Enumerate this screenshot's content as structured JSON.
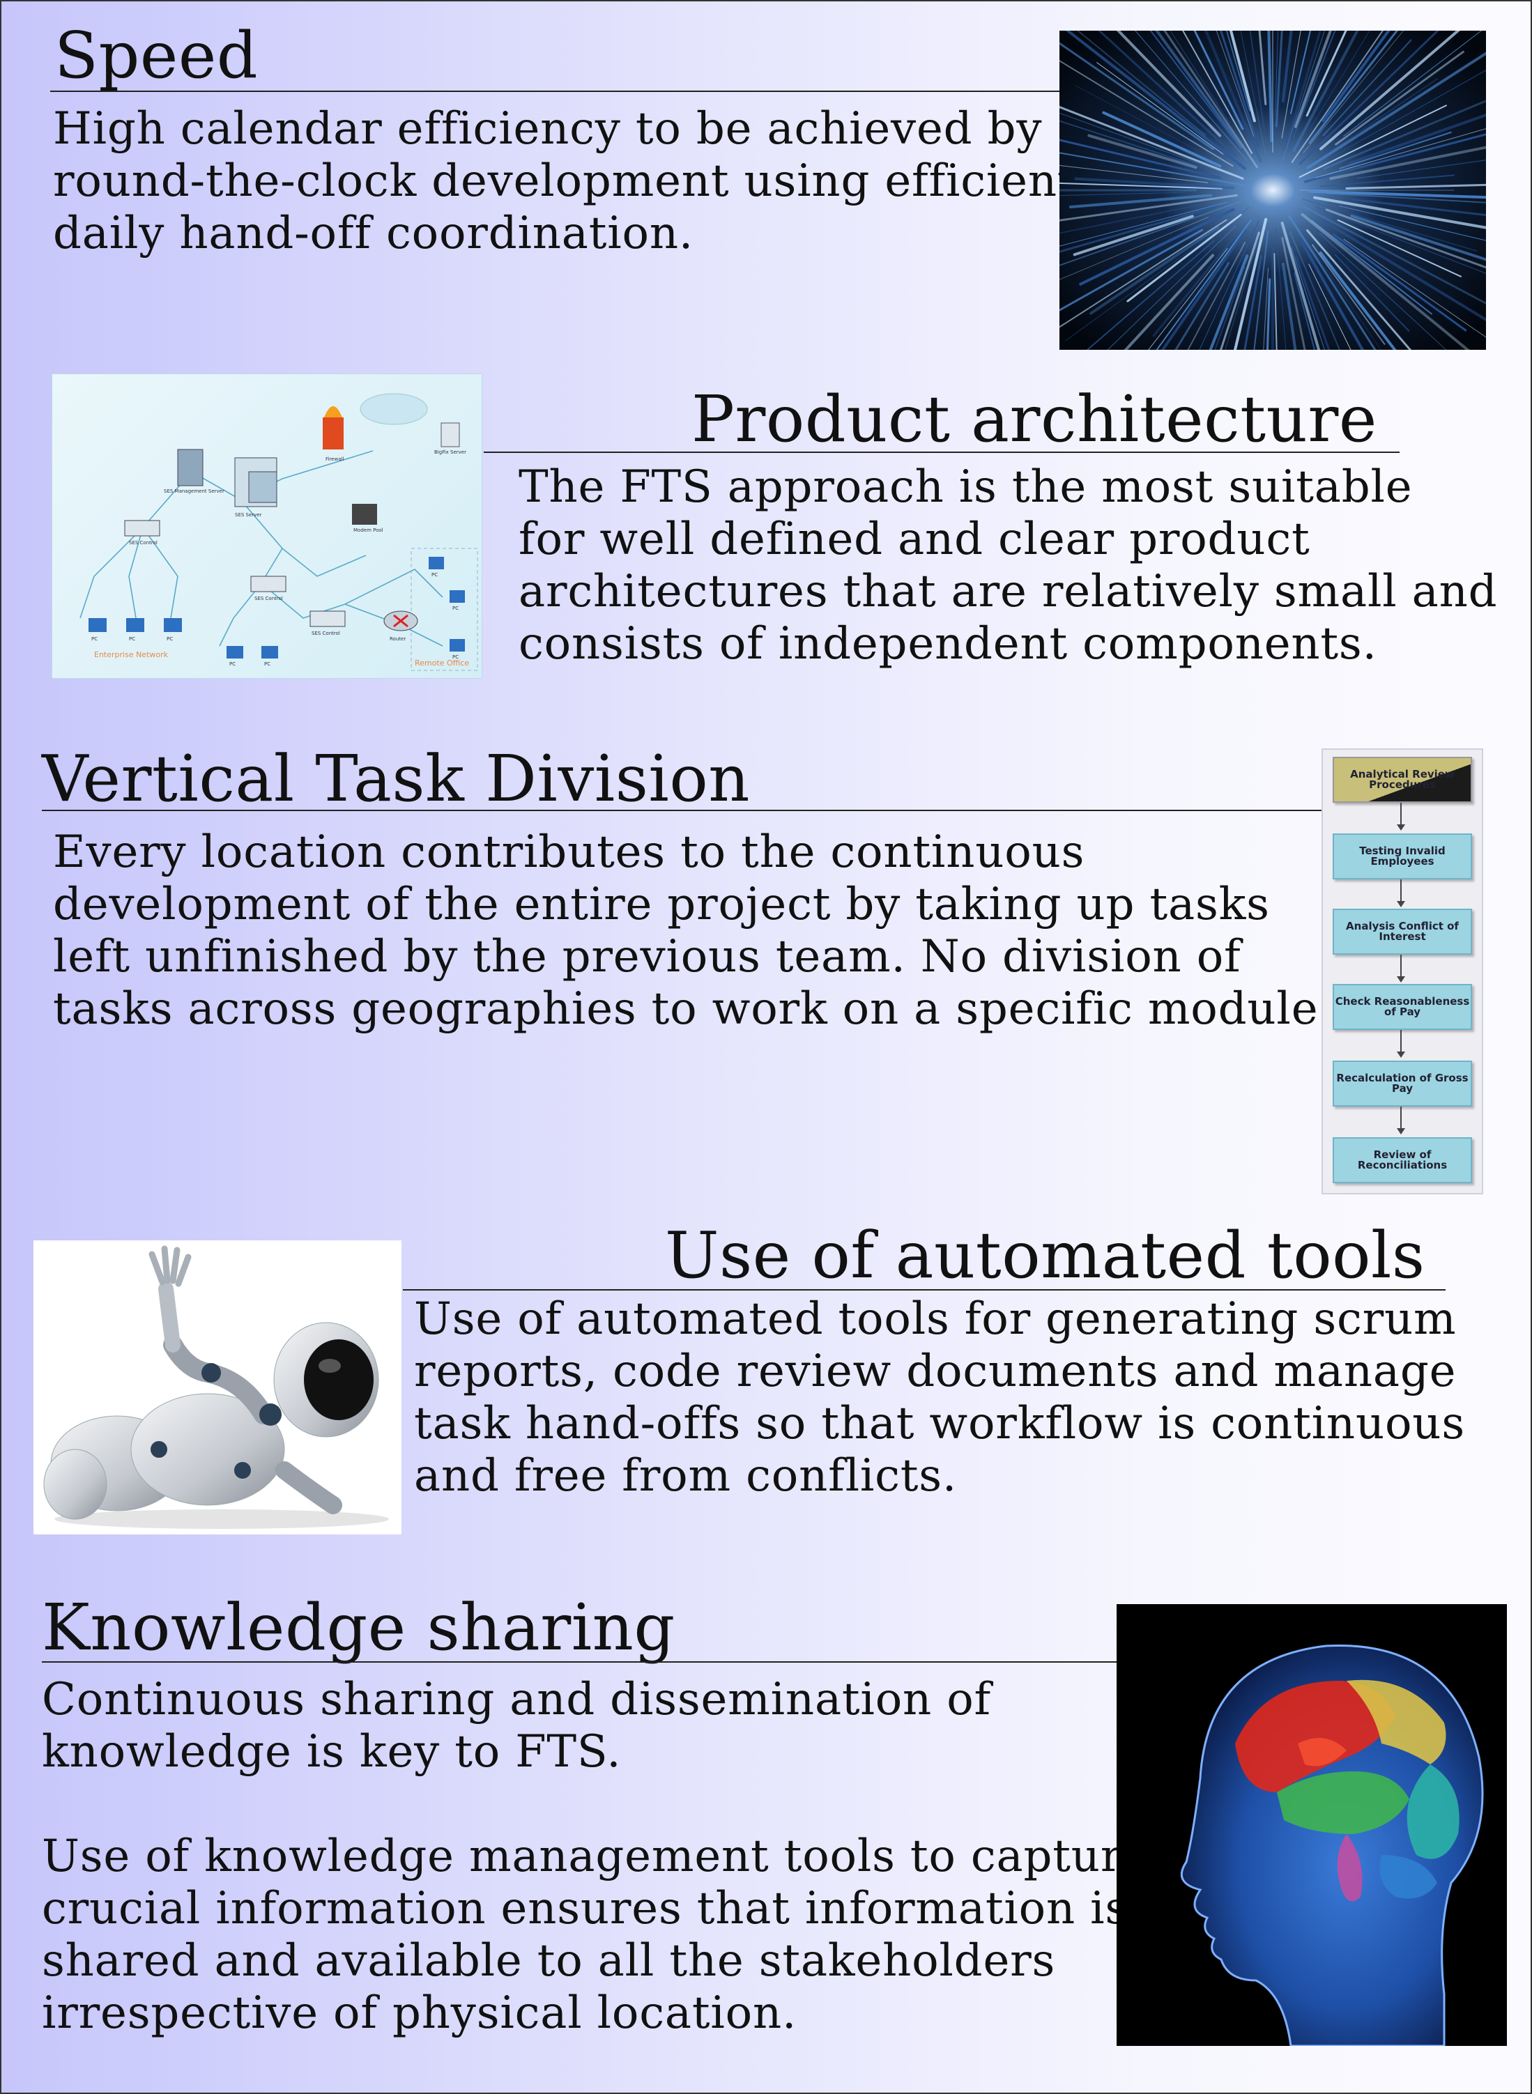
{
  "sections": [
    {
      "title": "Speed",
      "body": "High calendar efficiency to be achieved by\nround-the-clock development using efficient\ndaily hand-off coordination."
    },
    {
      "title": "Product architecture",
      "body": "The FTS approach is the most suitable\nfor well defined and clear product\narchitectures that are relatively small and\nconsists of independent components."
    },
    {
      "title": "Vertical Task Division",
      "body": "Every location contributes to the continuous\ndevelopment of the entire project by taking up tasks\nleft unfinished by the previous team. No division of\ntasks across geographies to work on a specific module."
    },
    {
      "title": "Use of automated tools",
      "body": "Use of automated tools for generating scrum\nreports, code review documents and manage\ntask hand-offs so that workflow is continuous\nand free from conflicts."
    },
    {
      "title": "Knowledge sharing",
      "body": "Continuous sharing and dissemination of\nknowledge is key to FTS.",
      "body2": "Use of knowledge management tools to capture\ncrucial information ensures that information is\nshared and available to all the stakeholders\nirrespective of physical location."
    }
  ],
  "network_diagram": {
    "labels": [
      "SES Management Server",
      "Firewall",
      "BigFix Server",
      "SES Server",
      "Modem Pool",
      "SES Control",
      "SES Control",
      "SES Control",
      "Router",
      "PC",
      "PC",
      "PC",
      "PC",
      "PC",
      "PC",
      "PC",
      "PC"
    ],
    "zone_enterprise": "Enterprise Network",
    "zone_remote": "Remote Office"
  },
  "flowchart": {
    "steps": [
      "Analytical Review Procedures",
      "Testing Invalid Employees",
      "Analysis Conflict of Interest",
      "Check Reasonableness of Pay",
      "Recalculation of Gross Pay",
      "Review of Reconciliations"
    ]
  }
}
